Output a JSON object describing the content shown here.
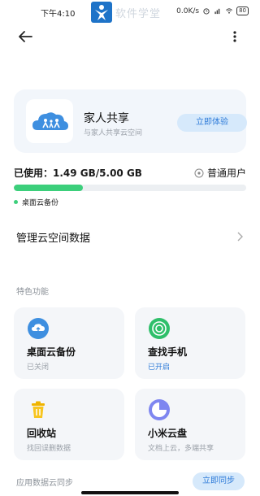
{
  "status_bar": {
    "time": "下午4:10",
    "network_speed": "0.0K/s",
    "battery": "80",
    "watermark": "软件学堂"
  },
  "family": {
    "title": "家人共享",
    "subtitle": "与家人共享云空间",
    "button": "立即体验"
  },
  "storage": {
    "used_label": "已使用：1.49 GB/5.00 GB",
    "used_fraction": 0.298,
    "user_type": "普通用户",
    "legend": "桌面云备份",
    "bar_color": "#3ccf7b"
  },
  "manage": {
    "label": "管理云空间数据"
  },
  "features": {
    "title": "特色功能",
    "items": [
      {
        "title": "桌面云备份",
        "subtitle": "已关闭",
        "icon": "cloud-upload-icon"
      },
      {
        "title": "查找手机",
        "subtitle": "已开启",
        "icon": "find-phone-icon"
      },
      {
        "title": "回收站",
        "subtitle": "找回误删数据",
        "icon": "trash-icon"
      },
      {
        "title": "小米云盘",
        "subtitle": "文档上云，多端共享",
        "icon": "pie-disk-icon"
      }
    ]
  },
  "sync": {
    "label": "应用数据云同步",
    "button": "立即同步"
  },
  "colors": {
    "accent": "#2e7bd8",
    "green": "#3ccf7b",
    "card_bg": "#f4f6f9"
  }
}
